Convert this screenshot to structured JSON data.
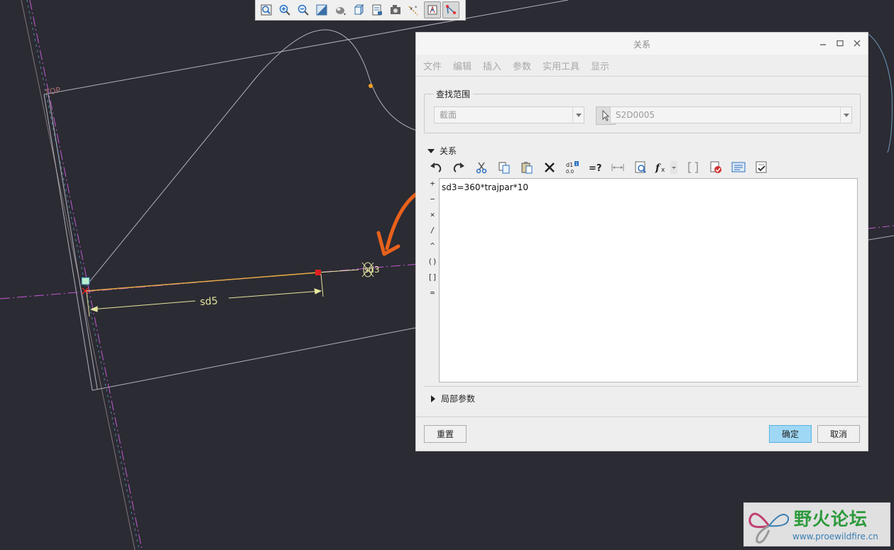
{
  "canvas": {
    "plane_label": "TOP",
    "dim_sd5": "sd5",
    "dim_sd3": "sd3"
  },
  "view_toolbar": {
    "icons": [
      "zoom-fit-icon",
      "zoom-in-icon",
      "zoom-out-icon",
      "reorient-icon",
      "display-style-icon",
      "saved-views-icon",
      "view-manager-icon",
      "perspective-icon",
      "datum-display-icon",
      "sketch-view-icon",
      "sketcher-display-icon"
    ]
  },
  "dialog": {
    "title": "关系",
    "menu": [
      "文件",
      "编辑",
      "插入",
      "参数",
      "实用工具",
      "显示"
    ],
    "lookin": {
      "legend": "查找范围",
      "type_value": "截面",
      "feature_value": "S2D0005"
    },
    "relations_label": "关系",
    "toolbar_icons": [
      "undo-icon",
      "redo-icon",
      "cut-icon",
      "copy-icon",
      "paste-icon",
      "delete-icon",
      "sort-icon",
      "evaluate-icon",
      "dimension-icon",
      "insert-parameter-icon",
      "function-icon",
      "brackets-icon",
      "verify-icon",
      "show-values-icon",
      "check-icon"
    ],
    "operators": [
      "+",
      "−",
      "×",
      "/",
      "^",
      "()",
      "[]",
      "="
    ],
    "relation_text": "sd3=360*trajpar*10",
    "local_params_label": "局部参数",
    "reset_label": "重置",
    "ok_label": "确定",
    "cancel_label": "取消"
  },
  "watermark": {
    "title": "野火论坛",
    "url": "www.proewildfire.cn"
  },
  "colors": {
    "background": "#2b2b33",
    "sketch_line": "#e2a843",
    "dimension": "#e6e6a0",
    "centerline": "#c45ad4",
    "callout_arrow": "#e8611b",
    "primary_button": "#9fd8f5"
  }
}
